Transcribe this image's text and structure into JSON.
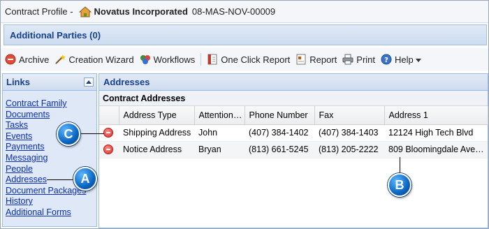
{
  "header": {
    "prefix": "Contract Profile -",
    "company": "Novatus Incorporated",
    "contract_id": "08-MAS-NOV-00009"
  },
  "additional_parties": "Additional Parties (0)",
  "toolbar": {
    "archive": "Archive",
    "wizard": "Creation Wizard",
    "workflows": "Workflows",
    "one_click": "One Click Report",
    "report": "Report",
    "print": "Print",
    "help": "Help"
  },
  "links": {
    "title": "Links",
    "items": [
      "Contract Family",
      "Documents",
      "Tasks",
      "Events",
      "Payments",
      "Messaging",
      "People",
      "Addresses",
      "Document Packages",
      "History",
      "Additional Forms"
    ]
  },
  "addresses": {
    "title": "Addresses",
    "subtitle": "Contract Addresses",
    "columns": [
      "Address Type",
      "Attention…",
      "Phone Number",
      "Fax",
      "Address 1"
    ],
    "rows": [
      [
        "Shipping Address",
        "John",
        "(407) 384-1402",
        "(407) 384-1403",
        "12124 High Tech Blvd"
      ],
      [
        "Notice Address",
        "Bryan",
        "(813) 661-5245",
        "(813) 205-2222",
        "809 Bloomingdale Ave…"
      ]
    ]
  },
  "callouts": {
    "a": "A",
    "b": "B",
    "c": "C"
  }
}
